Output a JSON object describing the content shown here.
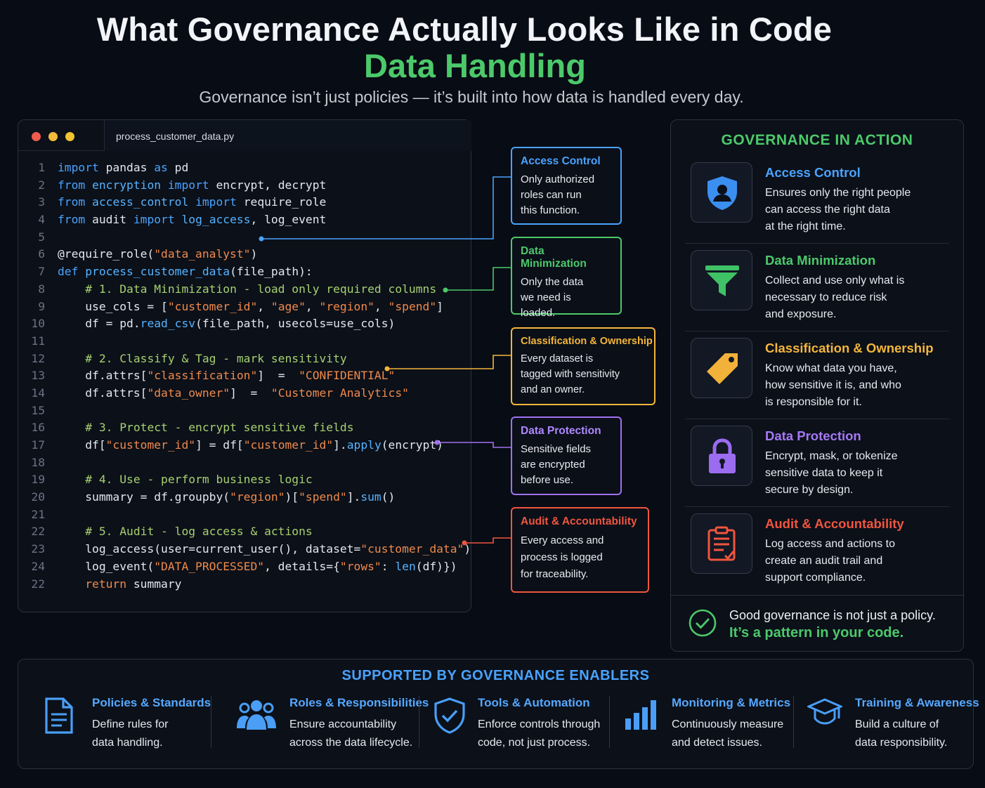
{
  "header": {
    "title": "What Governance Actually Looks Like in Code",
    "subtitle": "Data Handling",
    "tagline": "Governance isn’t just policies — it’s built into how data is handled every day."
  },
  "code_window": {
    "filename": "process_customer_data.py",
    "line_numbers": [
      "1",
      "2",
      "3",
      "4",
      "5",
      "6",
      "7",
      "8",
      "9",
      "10",
      "11",
      "12",
      "13",
      "14",
      "15",
      "16",
      "17",
      "18",
      "19",
      "20",
      "21",
      "22",
      "23",
      "24",
      "22"
    ]
  },
  "callouts": [
    {
      "title": "Access Control",
      "lines": [
        "Only authorized",
        "roles can run",
        "this function."
      ],
      "color": "#4aa3ff"
    },
    {
      "title": "Data Minimization",
      "lines": [
        "Only the data",
        "we need is",
        "loaded."
      ],
      "color": "#4cc96a"
    },
    {
      "title": "Classification & Ownership",
      "lines": [
        "Every dataset is",
        "tagged with sensitivity",
        "and an owner."
      ],
      "color": "#f4b63b"
    },
    {
      "title": "Data Protection",
      "lines": [
        "Sensitive fields",
        "are encrypted",
        "before use."
      ],
      "color": "#a070f0"
    },
    {
      "title": "Audit & Accountability",
      "lines": [
        "Every access and",
        "process is logged",
        "for traceability."
      ],
      "color": "#f0553f"
    }
  ],
  "governance": {
    "title": "GOVERNANCE IN ACTION",
    "items": [
      {
        "title": "Access Control",
        "lines": [
          "Ensures only the right people",
          "can access the right data",
          "at the right time."
        ],
        "color": "#4aa3ff",
        "icon": "shield-user-icon"
      },
      {
        "title": "Data Minimization",
        "lines": [
          "Collect and use only what is",
          "necessary to reduce risk",
          "and exposure."
        ],
        "color": "#4cc96a",
        "icon": "funnel-icon"
      },
      {
        "title": "Classification & Ownership",
        "lines": [
          "Know what data you have,",
          "how sensitive it is, and who",
          "is responsible for it."
        ],
        "color": "#f4b63b",
        "icon": "tag-icon"
      },
      {
        "title": "Data Protection",
        "lines": [
          "Encrypt, mask, or tokenize",
          "sensitive data to keep it",
          "secure by design."
        ],
        "color": "#a070f0",
        "icon": "lock-icon"
      },
      {
        "title": "Audit & Accountability",
        "lines": [
          "Log access and actions to",
          "create an audit trail and",
          "support compliance."
        ],
        "color": "#f0553f",
        "icon": "audit-document-icon"
      }
    ],
    "footer": {
      "line1": "Good governance is not just a policy.",
      "line2": "It’s a pattern in your code."
    }
  },
  "enablers": {
    "title": "SUPPORTED BY GOVERNANCE ENABLERS",
    "items": [
      {
        "title": "Policies & Standards",
        "lines": [
          "Define rules for",
          "data handling."
        ],
        "icon": "document-icon"
      },
      {
        "title": "Roles & Responsibilities",
        "lines": [
          "Ensure accountability",
          "across the data lifecycle."
        ],
        "icon": "people-icon"
      },
      {
        "title": "Tools & Automation",
        "lines": [
          "Enforce controls through",
          "code, not just process."
        ],
        "icon": "shield-check-icon"
      },
      {
        "title": "Monitoring & Metrics",
        "lines": [
          "Continuously measure",
          "and detect issues."
        ],
        "icon": "bar-chart-icon"
      },
      {
        "title": "Training & Awareness",
        "lines": [
          "Build a culture of",
          "data responsibility."
        ],
        "icon": "graduation-cap-icon"
      }
    ]
  }
}
